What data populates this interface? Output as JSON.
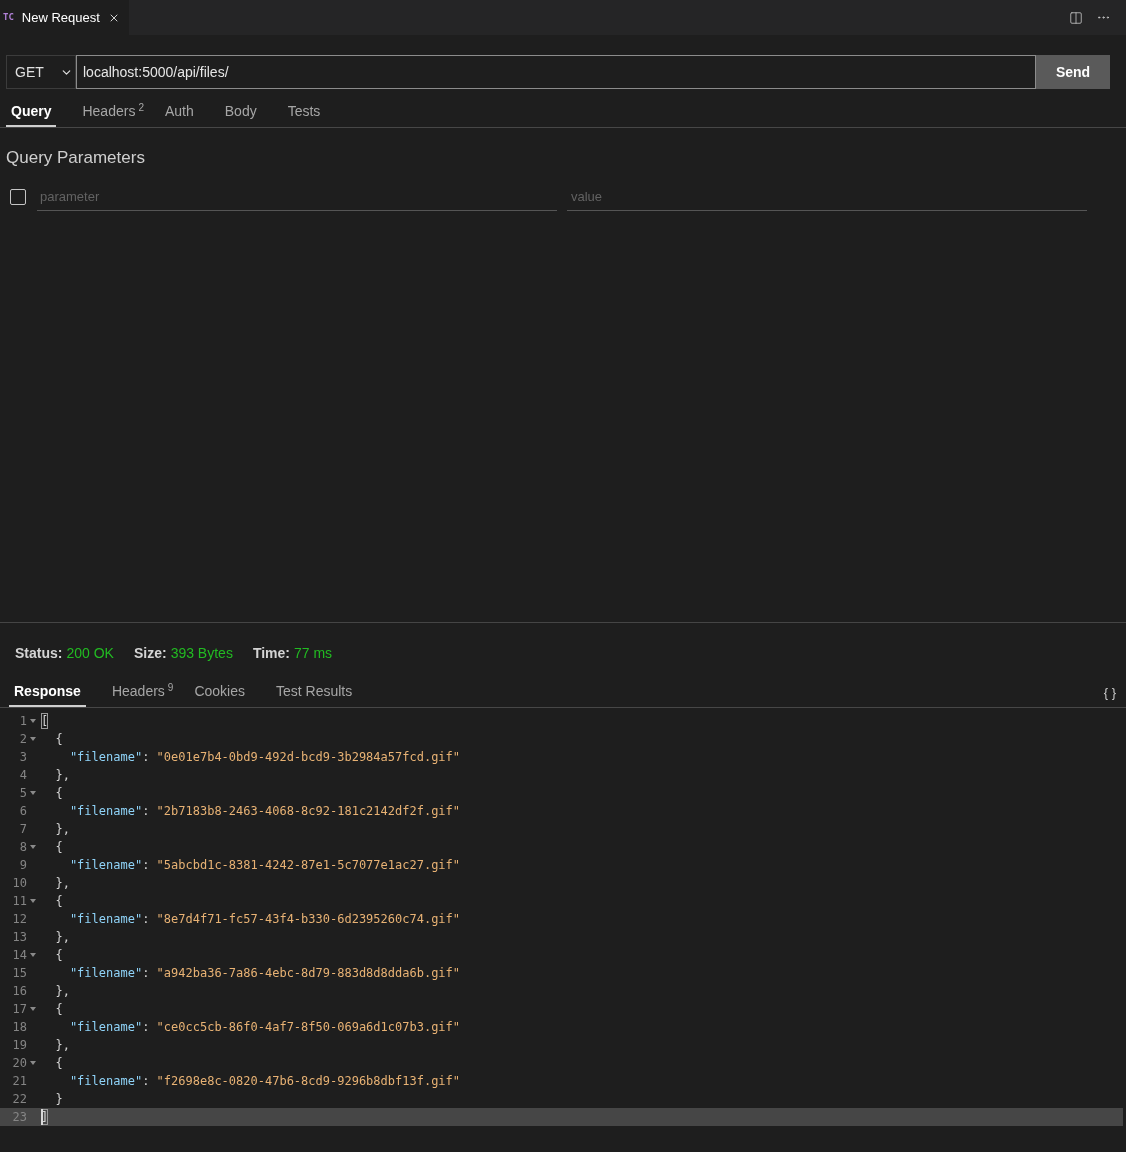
{
  "editor_tabs": [
    {
      "badge": "TC",
      "title": "New Request",
      "selected": true
    }
  ],
  "request": {
    "method": "GET",
    "url": "localhost:5000/api/files/",
    "send_label": "Send",
    "tabs": [
      {
        "label": "Query",
        "selected": true
      },
      {
        "label": "Headers",
        "count": "2",
        "selected": false
      },
      {
        "label": "Auth",
        "selected": false
      },
      {
        "label": "Body",
        "selected": false
      },
      {
        "label": "Tests",
        "selected": false
      }
    ]
  },
  "query_parameters": {
    "title": "Query Parameters",
    "rows": [
      {
        "checked": false,
        "parameter": {
          "placeholder": "parameter"
        },
        "value": {
          "placeholder": "value"
        }
      }
    ]
  },
  "response": {
    "meta": [
      {
        "label": "Status:",
        "value": "200 OK"
      },
      {
        "label": "Size:",
        "value": "393 Bytes"
      },
      {
        "label": "Time:",
        "value": "77 ms"
      }
    ],
    "tabs": [
      {
        "label": "Response",
        "selected": true
      },
      {
        "label": "Headers",
        "count": "9",
        "selected": false
      },
      {
        "label": "Cookies",
        "selected": false
      },
      {
        "label": "Test Results",
        "selected": false
      }
    ],
    "format_button": "{ }",
    "lines": [
      {
        "number": "1",
        "foldable": true,
        "current": false,
        "bracket_match": true,
        "tokens": [
          {
            "kind": "punct",
            "text": "["
          }
        ]
      },
      {
        "number": "2",
        "foldable": true,
        "current": false,
        "bracket_match": false,
        "tokens": [
          {
            "kind": "punct",
            "text": "  {"
          }
        ]
      },
      {
        "number": "3",
        "foldable": false,
        "current": false,
        "bracket_match": false,
        "tokens": [
          {
            "kind": "key",
            "text": "    \"filename\""
          },
          {
            "kind": "punct",
            "text": ": "
          },
          {
            "kind": "string",
            "text": "\"0e01e7b4-0bd9-492d-bcd9-3b2984a57fcd.gif\""
          }
        ]
      },
      {
        "number": "4",
        "foldable": false,
        "current": false,
        "bracket_match": false,
        "tokens": [
          {
            "kind": "punct",
            "text": "  },"
          }
        ]
      },
      {
        "number": "5",
        "foldable": true,
        "current": false,
        "bracket_match": false,
        "tokens": [
          {
            "kind": "punct",
            "text": "  {"
          }
        ]
      },
      {
        "number": "6",
        "foldable": false,
        "current": false,
        "bracket_match": false,
        "tokens": [
          {
            "kind": "key",
            "text": "    \"filename\""
          },
          {
            "kind": "punct",
            "text": ": "
          },
          {
            "kind": "string",
            "text": "\"2b7183b8-2463-4068-8c92-181c2142df2f.gif\""
          }
        ]
      },
      {
        "number": "7",
        "foldable": false,
        "current": false,
        "bracket_match": false,
        "tokens": [
          {
            "kind": "punct",
            "text": "  },"
          }
        ]
      },
      {
        "number": "8",
        "foldable": true,
        "current": false,
        "bracket_match": false,
        "tokens": [
          {
            "kind": "punct",
            "text": "  {"
          }
        ]
      },
      {
        "number": "9",
        "foldable": false,
        "current": false,
        "bracket_match": false,
        "tokens": [
          {
            "kind": "key",
            "text": "    \"filename\""
          },
          {
            "kind": "punct",
            "text": ": "
          },
          {
            "kind": "string",
            "text": "\"5abcbd1c-8381-4242-87e1-5c7077e1ac27.gif\""
          }
        ]
      },
      {
        "number": "10",
        "foldable": false,
        "current": false,
        "bracket_match": false,
        "tokens": [
          {
            "kind": "punct",
            "text": "  },"
          }
        ]
      },
      {
        "number": "11",
        "foldable": true,
        "current": false,
        "bracket_match": false,
        "tokens": [
          {
            "kind": "punct",
            "text": "  {"
          }
        ]
      },
      {
        "number": "12",
        "foldable": false,
        "current": false,
        "bracket_match": false,
        "tokens": [
          {
            "kind": "key",
            "text": "    \"filename\""
          },
          {
            "kind": "punct",
            "text": ": "
          },
          {
            "kind": "string",
            "text": "\"8e7d4f71-fc57-43f4-b330-6d2395260c74.gif\""
          }
        ]
      },
      {
        "number": "13",
        "foldable": false,
        "current": false,
        "bracket_match": false,
        "tokens": [
          {
            "kind": "punct",
            "text": "  },"
          }
        ]
      },
      {
        "number": "14",
        "foldable": true,
        "current": false,
        "bracket_match": false,
        "tokens": [
          {
            "kind": "punct",
            "text": "  {"
          }
        ]
      },
      {
        "number": "15",
        "foldable": false,
        "current": false,
        "bracket_match": false,
        "tokens": [
          {
            "kind": "key",
            "text": "    \"filename\""
          },
          {
            "kind": "punct",
            "text": ": "
          },
          {
            "kind": "string",
            "text": "\"a942ba36-7a86-4ebc-8d79-883d8d8dda6b.gif\""
          }
        ]
      },
      {
        "number": "16",
        "foldable": false,
        "current": false,
        "bracket_match": false,
        "tokens": [
          {
            "kind": "punct",
            "text": "  },"
          }
        ]
      },
      {
        "number": "17",
        "foldable": true,
        "current": false,
        "bracket_match": false,
        "tokens": [
          {
            "kind": "punct",
            "text": "  {"
          }
        ]
      },
      {
        "number": "18",
        "foldable": false,
        "current": false,
        "bracket_match": false,
        "tokens": [
          {
            "kind": "key",
            "text": "    \"filename\""
          },
          {
            "kind": "punct",
            "text": ": "
          },
          {
            "kind": "string",
            "text": "\"ce0cc5cb-86f0-4af7-8f50-069a6d1c07b3.gif\""
          }
        ]
      },
      {
        "number": "19",
        "foldable": false,
        "current": false,
        "bracket_match": false,
        "tokens": [
          {
            "kind": "punct",
            "text": "  },"
          }
        ]
      },
      {
        "number": "20",
        "foldable": true,
        "current": false,
        "bracket_match": false,
        "tokens": [
          {
            "kind": "punct",
            "text": "  {"
          }
        ]
      },
      {
        "number": "21",
        "foldable": false,
        "current": false,
        "bracket_match": false,
        "tokens": [
          {
            "kind": "key",
            "text": "    \"filename\""
          },
          {
            "kind": "punct",
            "text": ": "
          },
          {
            "kind": "string",
            "text": "\"f2698e8c-0820-47b6-8cd9-9296b8dbf13f.gif\""
          }
        ]
      },
      {
        "number": "22",
        "foldable": false,
        "current": false,
        "bracket_match": false,
        "tokens": [
          {
            "kind": "punct",
            "text": "  }"
          }
        ]
      },
      {
        "number": "23",
        "foldable": false,
        "current": true,
        "bracket_match": true,
        "tokens": [
          {
            "kind": "punct",
            "text": "]"
          }
        ]
      }
    ]
  }
}
